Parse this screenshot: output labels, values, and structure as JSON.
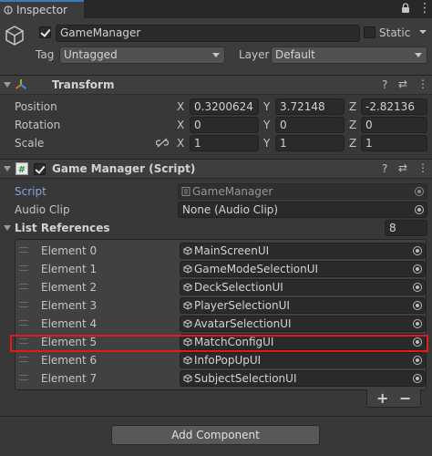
{
  "tab": {
    "label": "Inspector"
  },
  "gameobject": {
    "active": true,
    "name": "GameManager",
    "static_label": "Static",
    "tag_label": "Tag",
    "tag_value": "Untagged",
    "layer_label": "Layer",
    "layer_value": "Default"
  },
  "transform": {
    "title": "Transform",
    "position": {
      "label": "Position",
      "x": "0.3200624",
      "y": "3.72148",
      "z": "-2.82136"
    },
    "rotation": {
      "label": "Rotation",
      "x": "0",
      "y": "0",
      "z": "0"
    },
    "scale": {
      "label": "Scale",
      "x": "1",
      "y": "1",
      "z": "1"
    },
    "axis": {
      "x": "X",
      "y": "Y",
      "z": "Z"
    }
  },
  "script_component": {
    "title": "Game Manager (Script)",
    "enabled": true,
    "script_label": "Script",
    "script_value": "GameManager",
    "audio_label": "Audio Clip",
    "audio_value": "None (Audio Clip)",
    "list_label": "List References",
    "list_size": "8",
    "elements": [
      {
        "label": "Element 0",
        "value": "MainScreenUI"
      },
      {
        "label": "Element 1",
        "value": "GameModeSelectionUI"
      },
      {
        "label": "Element 2",
        "value": "DeckSelectionUI"
      },
      {
        "label": "Element 3",
        "value": "PlayerSelectionUI"
      },
      {
        "label": "Element 4",
        "value": "AvatarSelectionUI"
      },
      {
        "label": "Element 5",
        "value": "MatchConfigUI"
      },
      {
        "label": "Element 6",
        "value": "InfoPopUpUI"
      },
      {
        "label": "Element 7",
        "value": "SubjectSelectionUI"
      }
    ],
    "highlighted_index": 5,
    "plus": "+",
    "minus": "−"
  },
  "add_component": "Add Component",
  "icons": {
    "help": "?",
    "presets": "⇄",
    "more": "⋮"
  },
  "colors": {
    "highlight": "#e01b1b",
    "tab_accent": "#3a79bb",
    "script_link": "#7fa6d6"
  }
}
